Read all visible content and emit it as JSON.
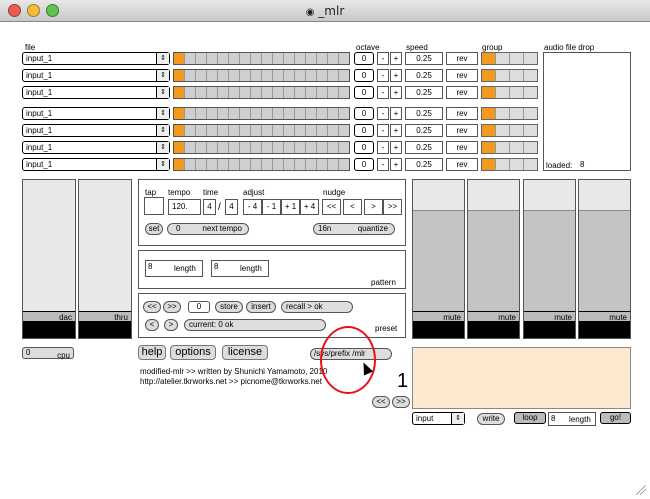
{
  "window": {
    "title": "_mlr"
  },
  "headers": {
    "file": "file",
    "octave": "octave",
    "speed": "speed",
    "group": "group",
    "drop": "audio file drop",
    "loaded_label": "loaded:",
    "loaded_value": "8"
  },
  "tracks": [
    {
      "file": "input_1",
      "octave": "0",
      "speed": "0.25",
      "rev": "rev",
      "group": 0
    },
    {
      "file": "input_1",
      "octave": "0",
      "speed": "0.25",
      "rev": "rev",
      "group": 0
    },
    {
      "file": "input_1",
      "octave": "0",
      "speed": "0.25",
      "rev": "rev",
      "group": 0
    },
    {
      "file": "input_1",
      "octave": "0",
      "speed": "0.25",
      "rev": "rev",
      "group": 0
    },
    {
      "file": "input_1",
      "octave": "0",
      "speed": "0.25",
      "rev": "rev",
      "group": 0
    },
    {
      "file": "input_1",
      "octave": "0",
      "speed": "0.25",
      "rev": "rev",
      "group": 0
    },
    {
      "file": "input_1",
      "octave": "0",
      "speed": "0.25",
      "rev": "rev",
      "group": 0
    }
  ],
  "octave_buttons": {
    "minus": "-",
    "plus": "+"
  },
  "left_sliders": [
    {
      "label": "dac"
    },
    {
      "label": "thru"
    }
  ],
  "transport": {
    "tap": "tap",
    "tempo": "tempo",
    "tempo_value": "120.",
    "time": "time",
    "time_num": "4",
    "time_sep": "/",
    "time_den": "4",
    "adjust": "adjust",
    "adjust_buttons": [
      "- 4",
      "- 1",
      "+ 1",
      "+ 4"
    ],
    "nudge": "nudge",
    "nudge_buttons": [
      "<<",
      "<",
      ">",
      ">>"
    ],
    "set": "set",
    "next_tempo_value": "0",
    "next_tempo": "next tempo",
    "quantize_value": "16n",
    "quantize": "quantize"
  },
  "pattern": {
    "label": "pattern",
    "length1_value": "8",
    "length1": "length",
    "length2_value": "8",
    "length2": "length"
  },
  "preset": {
    "label": "preset",
    "prev": "<<",
    "next": ">>",
    "number": "0",
    "store": "store",
    "insert": "insert",
    "recall": "recall > ok",
    "step_prev": "<",
    "step_next": ">",
    "current": "current: 0 ok"
  },
  "cpu": {
    "value": "0",
    "label": "cpu"
  },
  "footer_buttons": {
    "help": "help",
    "options": "options",
    "license": "license"
  },
  "prefix": "/sys/prefix /mlr",
  "credits": {
    "line1": "modified-mlr >> written by Shunichi Yamamoto, 2010",
    "line2": "http://atelier.tkrworks.net >> picnome@tkrworks.net"
  },
  "right_sliders": [
    {
      "label": "mute"
    },
    {
      "label": "mute"
    },
    {
      "label": "mute"
    },
    {
      "label": "mute"
    }
  ],
  "big_number": "1",
  "page_nav": {
    "prev": "<<",
    "next": ">>"
  },
  "input_menu": "input",
  "record": {
    "write": "write",
    "loop": "loop",
    "length_value": "8",
    "length": "length",
    "go": "go!"
  },
  "colors": {
    "accent": "#f39a1e",
    "drop_area": "#fde9d0",
    "annotation_circle": "#e11"
  }
}
